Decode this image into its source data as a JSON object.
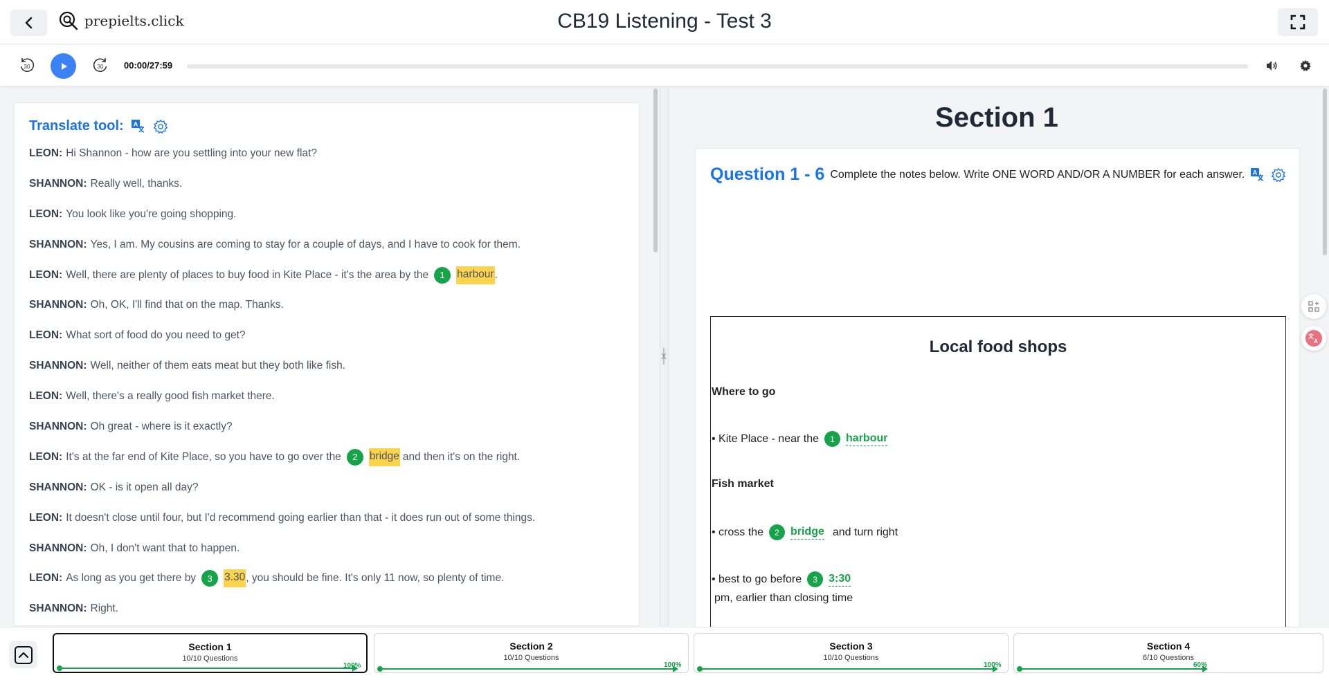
{
  "header": {
    "site_name": "prepielts.click",
    "title": "CB19 Listening - Test 3"
  },
  "audio": {
    "rewind_label": "30",
    "forward_label": "30",
    "current_time": "00:00",
    "separator": "/",
    "duration": "27:59",
    "progress": 0
  },
  "translate_tool": {
    "label": "Translate tool:"
  },
  "transcript": [
    {
      "speaker": "LEON:",
      "text": "Hi Shannon - how are you settling into your new flat?"
    },
    {
      "speaker": "SHANNON:",
      "text": "Really well, thanks."
    },
    {
      "speaker": "LEON:",
      "text": "You look like you're going shopping."
    },
    {
      "speaker": "SHANNON:",
      "text": "Yes, I am. My cousins are coming to stay for a couple of days, and I have to cook for them."
    },
    {
      "speaker": "LEON:",
      "before": "Well, there are plenty of places to buy food in Kite Place - it's the area by the",
      "qnum": "1",
      "answer": "harbour",
      "after": "."
    },
    {
      "speaker": "SHANNON:",
      "text": "Oh, OK, I'll find that on the map. Thanks."
    },
    {
      "speaker": "LEON:",
      "text": "What sort of food do you need to get?"
    },
    {
      "speaker": "SHANNON:",
      "text": "Well, neither of them eats meat but they both like fish."
    },
    {
      "speaker": "LEON:",
      "text": "Well, there's a really good fish market there."
    },
    {
      "speaker": "SHANNON:",
      "text": "Oh great - where is it exactly?"
    },
    {
      "speaker": "LEON:",
      "before": "It's at the far end of Kite Place, so you have to go over the",
      "qnum": "2",
      "answer": "bridge",
      "after": "and then it's on the right."
    },
    {
      "speaker": "SHANNON:",
      "text": "OK - is it open all day?"
    },
    {
      "speaker": "LEON:",
      "text": "It doesn't close until four, but I'd recommend going earlier than that - it does run out of some things."
    },
    {
      "speaker": "SHANNON:",
      "text": "Oh, I don't want that to happen."
    },
    {
      "speaker": "LEON:",
      "before": "As long as you get there by",
      "qnum": "3",
      "answer": "3.30",
      "after": ", you should be fine. It's only 11 now, so plenty of time."
    },
    {
      "speaker": "SHANNON:",
      "text": "Right."
    }
  ],
  "section_title": "Section 1",
  "question_block": {
    "range": "Question 1 - 6",
    "instruction": "Complete the notes below. Write ONE WORD AND/OR A NUMBER for each answer."
  },
  "notes": {
    "title": "Local food shops",
    "heading1": "Where to go",
    "item1_before": "• Kite Place - near the",
    "item1_qnum": "1",
    "item1_answer": "harbour",
    "heading2": "Fish market",
    "item2_before": "• cross the",
    "item2_qnum": "2",
    "item2_answer": "bridge",
    "item2_after": "and turn right",
    "item3_before": "• best to go before",
    "item3_qnum": "3",
    "item3_answer": "3:30",
    "item3_after": "pm, earlier than closing time"
  },
  "sections": [
    {
      "name": "Section 1",
      "count": "10/10 Questions",
      "percent": "100%",
      "progress": 1.0,
      "active": true
    },
    {
      "name": "Section 2",
      "count": "10/10 Questions",
      "percent": "100%",
      "progress": 1.0,
      "active": false
    },
    {
      "name": "Section 3",
      "count": "10/10 Questions",
      "percent": "100%",
      "progress": 1.0,
      "active": false
    },
    {
      "name": "Section 4",
      "count": "6/10 Questions",
      "percent": "60%",
      "progress": 0.6,
      "active": false
    }
  ],
  "colors": {
    "accent_blue": "#1a73e8",
    "play_blue": "#3b82f6",
    "answer_green": "#16a34a",
    "highlight_yellow": "#fcd34d"
  }
}
